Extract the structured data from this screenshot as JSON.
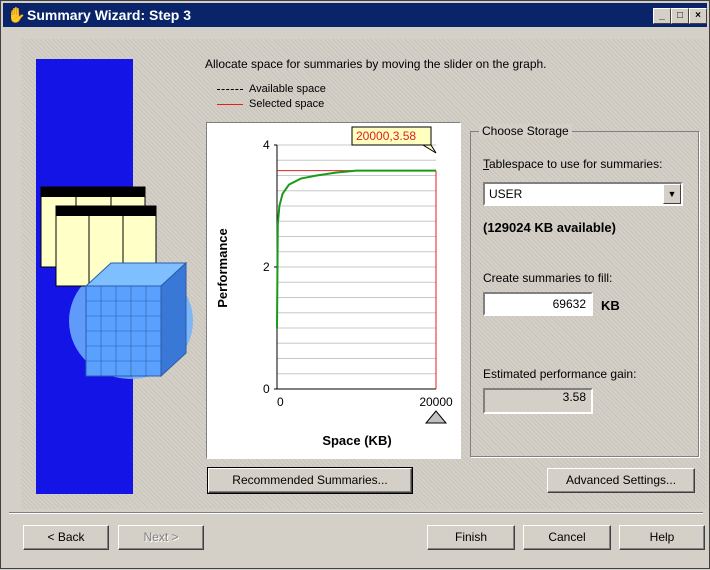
{
  "window": {
    "title": "Summary Wizard: Step 3",
    "controls": {
      "minimize": "_",
      "maximize": "□",
      "close": "×"
    }
  },
  "intro": "Allocate space for summaries by moving the slider on the graph.",
  "legend": {
    "available": "Available space",
    "selected": "Selected space",
    "available_color": "#000000",
    "selected_color": "#e02020"
  },
  "chart_data": {
    "type": "line",
    "xlabel": "Space (KB)",
    "ylabel": "Performance",
    "xlim": [
      0,
      20000
    ],
    "ylim": [
      0,
      4
    ],
    "xticks": [
      "0",
      "20000"
    ],
    "yticks": [
      "0",
      "2",
      "4"
    ],
    "series": [
      {
        "color": "#1a9a1a",
        "x": [
          0,
          100,
          300,
          700,
          1500,
          3000,
          5000,
          7500,
          10000,
          12500,
          15000,
          20000
        ],
        "y": [
          1.0,
          2.7,
          3.0,
          3.2,
          3.35,
          3.45,
          3.5,
          3.55,
          3.58,
          3.58,
          3.58,
          3.58
        ]
      }
    ],
    "selected_space_line": {
      "x": 20000,
      "y": 3.58,
      "color": "#e02020"
    },
    "tooltip": "20000,3.58",
    "grid": true
  },
  "storage": {
    "group_title": "Choose Storage",
    "tablespace_label": "Tablespace to use for summaries:",
    "tablespace_value": "USER",
    "available_text": "(129024 KB available)",
    "fill_label": "Create summaries to fill:",
    "fill_value": "69632",
    "fill_unit": "KB",
    "gain_label": "Estimated performance gain:",
    "gain_value": "3.58"
  },
  "buttons": {
    "recommended": "Recommended Summaries...",
    "advanced": "Advanced Settings...",
    "back": "< Back",
    "next": "Next >",
    "finish": "Finish",
    "cancel": "Cancel",
    "help": "Help"
  }
}
